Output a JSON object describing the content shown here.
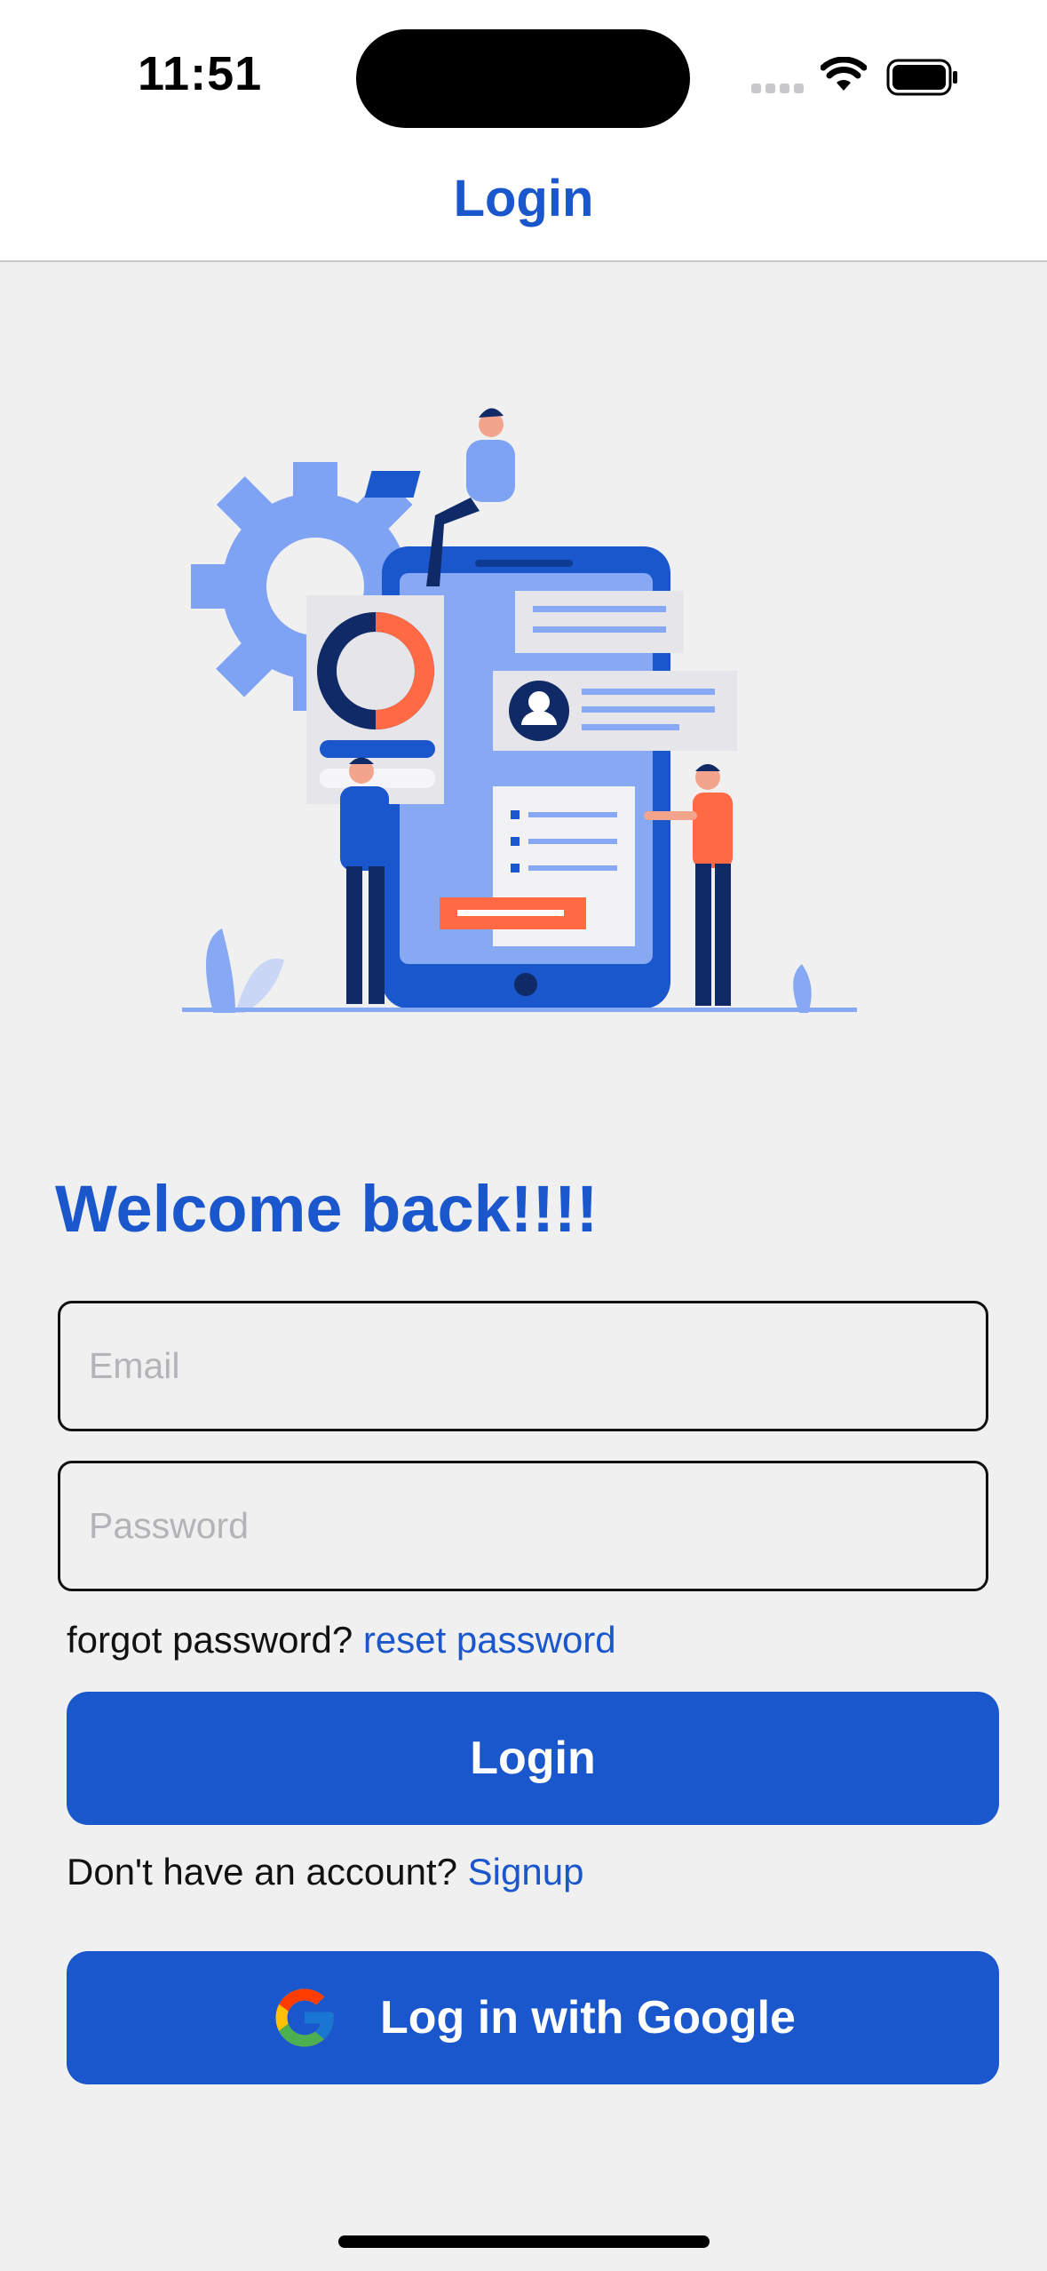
{
  "status_bar": {
    "time": "11:51"
  },
  "nav": {
    "title": "Login"
  },
  "illustration": {
    "name": "login-illustration"
  },
  "main": {
    "welcome": "Welcome back!!!!",
    "email_placeholder": "Email",
    "password_placeholder": "Password",
    "forgot_text": "forgot password?",
    "reset_link": "reset password",
    "login_button": "Login",
    "no_account_text": "Don't have an account?",
    "signup_link": "Signup",
    "google_button": "Log in with Google"
  },
  "colors": {
    "accent": "#1a56cc",
    "background": "#f0f0f1"
  },
  "icons": [
    "wifi-icon",
    "battery-icon",
    "signal-icon",
    "google-icon"
  ]
}
